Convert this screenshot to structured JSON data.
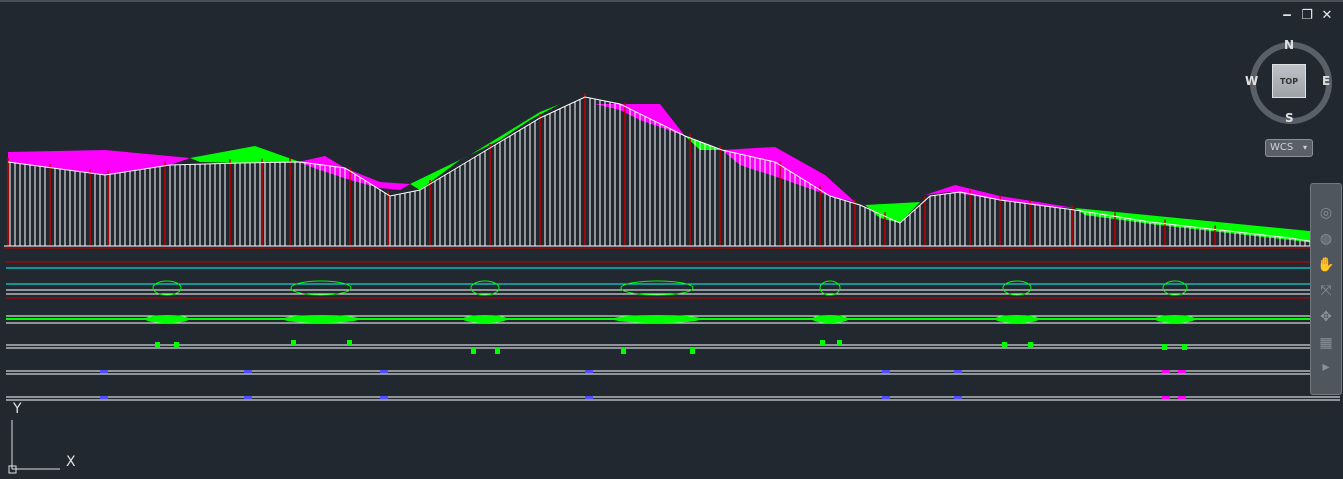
{
  "window_controls": {
    "minimize": "‒",
    "restore": "❐",
    "close": "✕"
  },
  "viewcube": {
    "face_label": "TOP",
    "north": "N",
    "south": "S",
    "east": "E",
    "west": "W"
  },
  "wcs": {
    "label": "WCS",
    "caret": "▾"
  },
  "ucs_icon": {
    "x_label": "X",
    "y_label": "Y"
  },
  "colors": {
    "background": "#212830",
    "cut_fill": "#ff00ff",
    "fill": "#00ff00",
    "hatch": "#ffffff",
    "station_line": "#c00000",
    "band_line": "#00ffff"
  }
}
